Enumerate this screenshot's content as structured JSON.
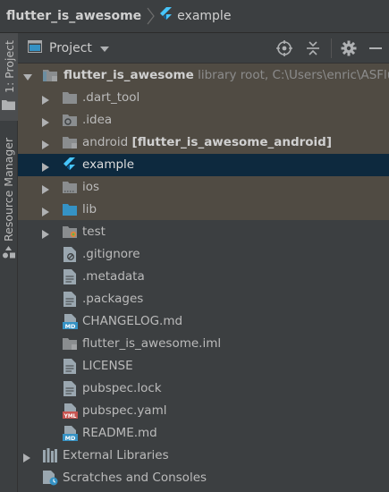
{
  "breadcrumb": {
    "root": "flutter_is_awesome",
    "child": "example"
  },
  "sidebar": {
    "project_tab": "1: Project",
    "resource_tab": "Resource Manager"
  },
  "header": {
    "view_label": "Project"
  },
  "tree": {
    "root": {
      "name": "flutter_is_awesome",
      "hint": "library root,  C:\\Users\\enric\\ASFlut"
    },
    "items": [
      {
        "label": ".dart_tool"
      },
      {
        "label": ".idea"
      },
      {
        "label": "android",
        "bold": "[flutter_is_awesome_android]"
      },
      {
        "label": "example"
      },
      {
        "label": "ios"
      },
      {
        "label": "lib"
      },
      {
        "label": "test"
      },
      {
        "label": ".gitignore"
      },
      {
        "label": ".metadata"
      },
      {
        "label": ".packages"
      },
      {
        "label": "CHANGELOG.md"
      },
      {
        "label": "flutter_is_awesome.iml"
      },
      {
        "label": "LICENSE"
      },
      {
        "label": "pubspec.lock"
      },
      {
        "label": "pubspec.yaml"
      },
      {
        "label": "README.md"
      }
    ],
    "external": "External Libraries",
    "scratches": "Scratches and Consoles"
  },
  "colors": {
    "background": "#3c3f41",
    "module_bg": "#504b43",
    "selection": "#0d293e",
    "folder": "#8a8d8f",
    "flutter": "#47c5fb",
    "accent_blue": "#3592c4"
  }
}
